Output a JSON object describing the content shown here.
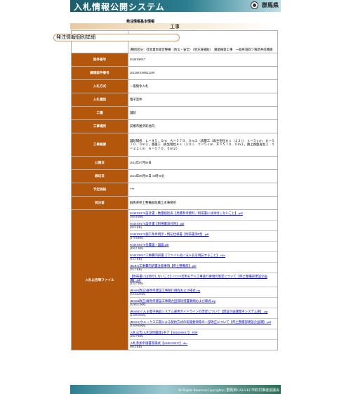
{
  "header": {
    "title": "入札情報公開システム",
    "prefecture": "群馬県"
  },
  "section_title": "発注情報基本情報",
  "tab": {
    "category": "工事"
  },
  "detail_title": "発注情報個別詳細",
  "category_desc": "[種別区分：社会資本総合整備（防災・安全）（地方道補助）　鏑第線第工事　一般県道四ツ塚新井前橋線",
  "fields": [
    {
      "label": "案件番号",
      "value": "S040100017"
    },
    {
      "label": "調達案件番号",
      "value": "2022001000022209"
    },
    {
      "label": "入札方式",
      "value": "一般競争入札"
    },
    {
      "label": "入札種別",
      "value": "電子案件"
    },
    {
      "label": "工種",
      "value": "舗装"
    },
    {
      "label": "工事場所",
      "value": "前橋市勝沢町地内"
    },
    {
      "label": "工事概要",
      "value": "舗装補修　Ｌ＝９５．０ｍ　Ａ＝５７０．０ｍ２（表層工（再生密粒Ａｓ（１３））　ｔ＝５ｃｍ　Ａ＝５７０．０ｍ２，基層工（再生粗粒Ａｓ（２０））　ｔ＝５ｃｍ　Ａ＝５７０．０ｍ２，路上路盤再生工　ｔ＝２２ｃｍ　Ａ＝５７０．０ｍ２）"
    },
    {
      "label": "公開日",
      "value": "2022年07月06日"
    },
    {
      "label": "締切日",
      "value": "2022年08月03日 10時30分"
    },
    {
      "label": "予定価格",
      "value": "***"
    },
    {
      "label": "発注者",
      "value": "群馬県県土整備部前橋土木事務所"
    }
  ],
  "files_label": "入札公告等ファイル",
  "files": [
    {
      "name": "S040100170設計書・数量総括表【見積参考資料／附帯書には添付しないこと】.pdf",
      "size": "(569.8 KB)"
    },
    {
      "name": "S040100170設計書【附帯書添付用】.pdf",
      "size": "(98.9 KB)"
    },
    {
      "name": "S040100170施工条件明示・特記仕様書【附帯書添付】.pdf",
      "size": "(178.8 KB)"
    },
    {
      "name": "S040100170位置図・図面.pdf",
      "size": "(490.1 KB)"
    },
    {
      "name": "S040100017工事費内訳書【ファイル名に法人名を明記すること】.xlsx",
      "size": "(14.7 KB)"
    },
    {
      "name": "(R2R3)工事費内訳書注意事項【県土整備部】.pdf",
      "size": "(76.7 KB)"
    },
    {
      "name": "【附帯書には添付しないこと】CCUS活用モデル工事試行要領の策定について【県土整備部建設企画課】.pdf",
      "size": "(224.7 KB)"
    },
    {
      "name": "(R0404改正)群馬県建設工事執行規程および様式.zip",
      "size": "(3,144.2 KB)"
    },
    {
      "name": "(R0404改正)群馬県建設工事暴力団排除措置要綱および様式.zip",
      "size": "(3,003.1 KB)"
    },
    {
      "name": "(R0404)ぐんま電子納品システム運用ガイドラインの改定について【建設企画課電子システム係】.zip",
      "size": "(2,689.0 KB)"
    },
    {
      "name": "(R0312)ウェークス工期による契約方式の実施要領等の一部改正について【県土整備部建設企画課】.pdf",
      "size": "(1,819.6 KB)"
    },
    {
      "name": "入札公告(入札説明書第1条ア【S040100017】.PDF",
      "size": "(282.7 KB)"
    },
    {
      "name": "入札参加申請書等様式【S040100017】.doc",
      "size": "(30.5 KB)"
    }
  ],
  "footer": {
    "copyright": "All Rights Reserved,Copyright(c) 群馬県CALS/EC市町村推進協議会"
  }
}
